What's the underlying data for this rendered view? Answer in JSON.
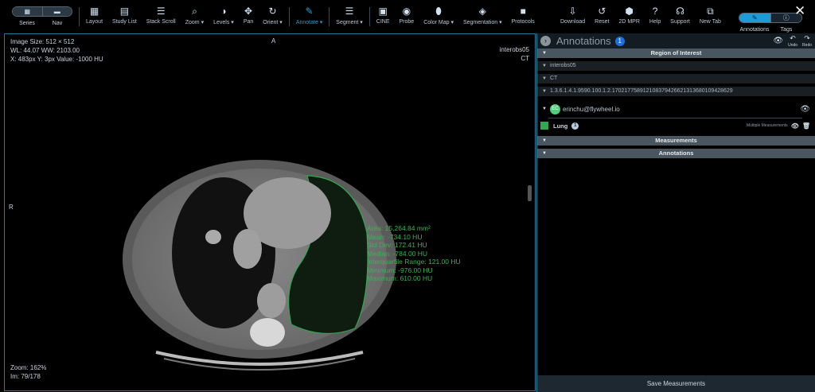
{
  "toolbar": {
    "series": "Series",
    "nav": "Nav",
    "tools": [
      {
        "label": "Layout",
        "icon": "▦"
      },
      {
        "label": "Study List",
        "icon": "▤"
      },
      {
        "label": "Stack Scroll",
        "icon": "☰"
      },
      {
        "label": "Zoom ▾",
        "icon": "⌕"
      },
      {
        "label": "Levels ▾",
        "icon": "◑"
      },
      {
        "label": "Pan",
        "icon": "✥"
      },
      {
        "label": "Orient ▾",
        "icon": "↻"
      }
    ],
    "annotate": {
      "label": "Annotate ▾",
      "icon": "✎"
    },
    "segment": {
      "label": "Segment ▾",
      "icon": "☰"
    },
    "tools2": [
      {
        "label": "CINE",
        "icon": "▣"
      },
      {
        "label": "Probe",
        "icon": "◉"
      },
      {
        "label": "Color Map ▾",
        "icon": "⬮"
      },
      {
        "label": "Segmentation ▾",
        "icon": "◈"
      },
      {
        "label": "Protocols",
        "icon": "■"
      }
    ],
    "right_tools": [
      {
        "label": "Download",
        "icon": "⇩"
      },
      {
        "label": "Reset",
        "icon": "↺"
      },
      {
        "label": "2D MPR",
        "icon": "⬢"
      },
      {
        "label": "Help",
        "icon": "?"
      },
      {
        "label": "Support",
        "icon": "☊"
      },
      {
        "label": "New Tab",
        "icon": "⧉"
      }
    ],
    "annotations_toggle": "Annotations",
    "tags_toggle": "Tags",
    "close": "✕"
  },
  "viewport": {
    "image_size": "Image Size: 512 × 512",
    "wlww": "WL: 44.07 WW: 2103.00",
    "probe": "X: 483px Y: 3px Value: -1000 HU",
    "patient": "interobs05",
    "modality": "CT",
    "orient_top": "A",
    "orient_left": "R",
    "zoom": "Zoom: 162%",
    "image_index": "Im: 79/178",
    "stats": [
      "Area: 15,264.84 mm²",
      "Mean: -734.10 HU",
      "Std Dev: 172.41 HU",
      "Median: -784.00 HU",
      "Interquartile Range: 121.00 HU",
      "Minimum: -976.00 HU",
      "Maximum: 610.00 HU"
    ],
    "roi_color": "#2fa84f"
  },
  "panel": {
    "title": "Annotations",
    "count": "1",
    "undo": "Undo",
    "redo": "Redo",
    "roi_header": "Region of Interest",
    "rows": [
      "interobs05",
      "CT",
      "1.3.6.1.4.1.9590.100.1.2.170217758912108379426621313680109428629"
    ],
    "user_initials": "EC",
    "user": "erinchu@flywheel.io",
    "label": "Lung",
    "label_count": "1",
    "label_note": "Multiple Measurements",
    "measurements": "Measurements",
    "annotations": "Annotations",
    "save": "Save Measurements"
  }
}
